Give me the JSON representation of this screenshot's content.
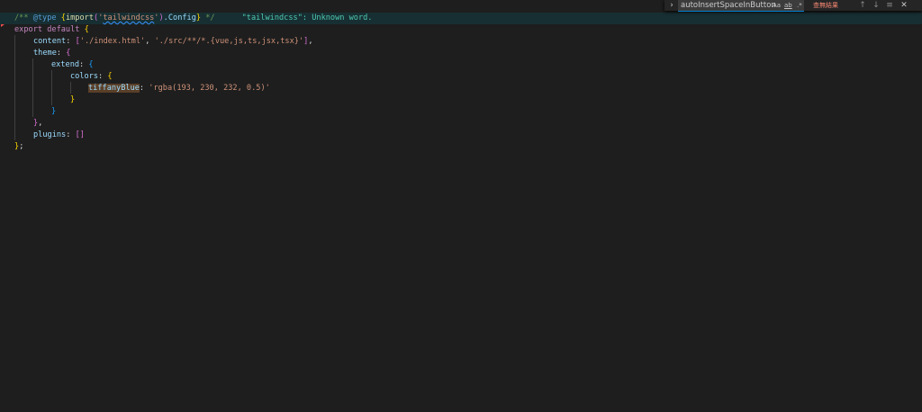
{
  "editor": {
    "diagnostic": "\"tailwindcss\": Unknown word.",
    "lines": {
      "l1": {
        "comment_a": "/** ",
        "comment_b": "@type",
        "comment_c": " ",
        "brace_open": "{",
        "import": "import",
        "paren_open": "(",
        "quote_open": "'",
        "module": "tailwindcss",
        "quote_close": "'",
        "paren_close": ")",
        "config": ".Config",
        "brace_close": "}",
        "comment_end": " */"
      },
      "l2": {
        "kw1": "export",
        "sp": " ",
        "kw2": "default",
        "sp2": " ",
        "brace": "{"
      },
      "l3": {
        "key": "content",
        "colon": ": ",
        "bracket_open": "[",
        "s1": "'./index.html'",
        "comma": ", ",
        "s2": "'./src/**/*.{vue,js,ts,jsx,tsx}'",
        "bracket_close": "]",
        "end": ","
      },
      "l4": {
        "key": "theme",
        "colon": ": ",
        "brace": "{"
      },
      "l5": {
        "key": "extend",
        "colon": ": ",
        "brace": "{"
      },
      "l6": {
        "key": "colors",
        "colon": ": ",
        "brace": "{"
      },
      "l7": {
        "key": "tiffanyBlue",
        "colon": ": ",
        "value": "'rgba(193, 230, 232, 0.5)'"
      },
      "l8": {
        "brace": "}"
      },
      "l9": {
        "brace": "}"
      },
      "l10": {
        "brace": "}",
        "end": ","
      },
      "l11": {
        "key": "plugins",
        "colon": ": ",
        "value": "[]"
      },
      "l12": {
        "brace": "}",
        "end": ";"
      }
    }
  },
  "find_widget": {
    "toggle_icon": "chevron-right-icon",
    "query": "autoInsertSpaceInButton",
    "match_case_label": "Aa",
    "whole_word_label": "ab",
    "regex_label": ".*",
    "no_results": "查無結果",
    "prev_icon": "arrow-up-icon",
    "next_icon": "arrow-down-icon",
    "selection_icon": "find-in-selection-icon",
    "close_icon": "close-icon"
  },
  "colors": {
    "background": "#1e1e1e",
    "current_line": "#172f33",
    "error_marker": "#f14c4c",
    "no_results": "#f48771"
  }
}
